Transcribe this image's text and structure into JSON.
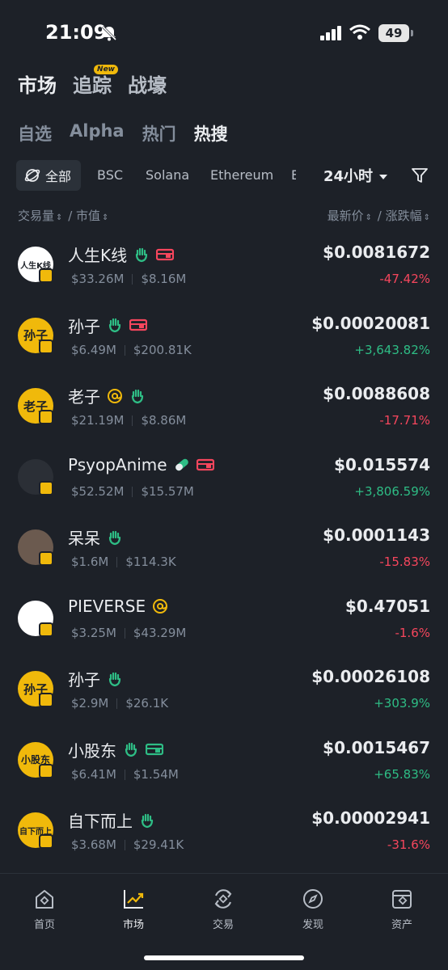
{
  "status": {
    "time": "21:09",
    "battery": "49"
  },
  "top_tabs": [
    {
      "label": "市场",
      "active": true
    },
    {
      "label": "追踪",
      "badge": "New"
    },
    {
      "label": "战壕"
    }
  ],
  "sub_tabs": [
    {
      "label": "自选"
    },
    {
      "label": "Alpha"
    },
    {
      "label": "热门"
    },
    {
      "label": "热搜",
      "active": true
    }
  ],
  "chains": {
    "all": "全部",
    "items": [
      "BSC",
      "Solana",
      "Ethereum",
      "E"
    ]
  },
  "time_filter": "24小时",
  "columns": {
    "left": "交易量",
    "left2": "市值",
    "right": "最新价",
    "right2": "涨跌幅",
    "slash": "/"
  },
  "tokens": [
    {
      "name": "人生K线",
      "volume": "$33.26M",
      "mcap": "$8.16M",
      "price": "$0.0081672",
      "change": "-47.42%",
      "dir": "down",
      "avatar_text": "人生K线",
      "avatar_bg": "#ffffff",
      "tags": [
        "hand-icon",
        "pill-red-icon"
      ]
    },
    {
      "name": "孙子",
      "volume": "$6.49M",
      "mcap": "$200.81K",
      "price": "$0.00020081",
      "change": "+3,643.82%",
      "dir": "up",
      "avatar_text": "孙子",
      "avatar_bg": "#f0b90b",
      "tags": [
        "hand-icon",
        "pill-red-icon"
      ]
    },
    {
      "name": "老子",
      "volume": "$21.19M",
      "mcap": "$8.86M",
      "price": "$0.0088608",
      "change": "-17.71%",
      "dir": "down",
      "avatar_text": "老子",
      "avatar_bg": "#f0b90b",
      "tags": [
        "at-icon",
        "hand-icon"
      ]
    },
    {
      "name": "PsyopAnime",
      "volume": "$52.52M",
      "mcap": "$15.57M",
      "price": "$0.015574",
      "change": "+3,806.59%",
      "dir": "up",
      "avatar_text": "",
      "avatar_bg": "#2b2f36",
      "tags": [
        "capsule-icon",
        "pill-red-icon"
      ]
    },
    {
      "name": "呆呆",
      "volume": "$1.6M",
      "mcap": "$114.3K",
      "price": "$0.0001143",
      "change": "-15.83%",
      "dir": "down",
      "avatar_text": "",
      "avatar_bg": "#6b5a4f",
      "tags": [
        "hand-icon"
      ]
    },
    {
      "name": "PIEVERSE",
      "volume": "$3.25M",
      "mcap": "$43.29M",
      "price": "$0.47051",
      "change": "-1.6%",
      "dir": "down",
      "avatar_text": "",
      "avatar_bg": "#ffffff",
      "tags": [
        "at-icon"
      ]
    },
    {
      "name": "孙子",
      "volume": "$2.9M",
      "mcap": "$26.1K",
      "price": "$0.00026108",
      "change": "+303.9%",
      "dir": "up",
      "avatar_text": "孙子",
      "avatar_bg": "#f0b90b",
      "tags": [
        "hand-icon"
      ]
    },
    {
      "name": "小股东",
      "volume": "$6.41M",
      "mcap": "$1.54M",
      "price": "$0.0015467",
      "change": "+65.83%",
      "dir": "up",
      "avatar_text": "小股东",
      "avatar_bg": "#f0b90b",
      "tags": [
        "hand-icon",
        "pill-green-icon"
      ]
    },
    {
      "name": "自下而上",
      "volume": "$3.68M",
      "mcap": "$29.41K",
      "price": "$0.00002941",
      "change": "-31.6%",
      "dir": "down",
      "avatar_text": "自下而上",
      "avatar_bg": "#f0b90b",
      "tags": [
        "hand-icon"
      ]
    }
  ],
  "bottom_nav": [
    {
      "label": "首页",
      "icon": "home-icon"
    },
    {
      "label": "市场",
      "icon": "market-icon",
      "active": true
    },
    {
      "label": "交易",
      "icon": "trade-icon"
    },
    {
      "label": "发现",
      "icon": "discover-icon"
    },
    {
      "label": "资产",
      "icon": "wallet-icon"
    }
  ],
  "colors": {
    "background": "#1d2128",
    "accent": "#f0b90b",
    "up": "#2ebd85",
    "down": "#f6465d"
  }
}
